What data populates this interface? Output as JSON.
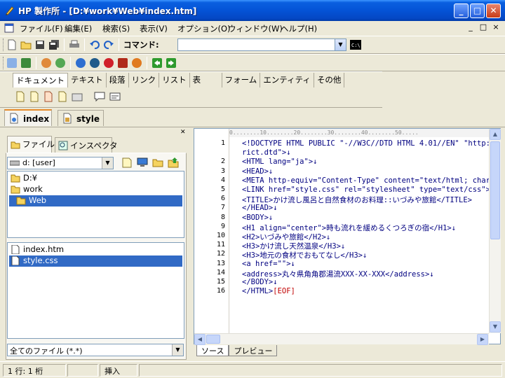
{
  "window": {
    "title": "HP 製作所 - [D:¥work¥Web¥index.htm]",
    "min_glyph": "_",
    "max_glyph": "□",
    "close_glyph": "✕"
  },
  "menu": [
    "ファイル(F)",
    "編集(E)",
    "検索(S)",
    "表示(V)",
    "オプション(O)",
    "ウィンドウ(W)",
    "ヘルプ(H)"
  ],
  "mdi_buttons": [
    "_",
    "□",
    "×"
  ],
  "command": {
    "label": "コマンド:",
    "value": ""
  },
  "tag_tabs": [
    "ドキュメント",
    "テキスト",
    "段落",
    "リンク",
    "リスト",
    "表",
    "フォーム",
    "エンティティ",
    "その他"
  ],
  "doc_tabs": [
    "index",
    "style"
  ],
  "left_panel": {
    "tabs": [
      "ファイル",
      "インスペクタ"
    ],
    "drive": "d: [user]",
    "folders": [
      "D:¥",
      "work",
      "Web"
    ],
    "files": [
      "index.htm",
      "style.css"
    ],
    "filter": "全てのファイル (*.*)"
  },
  "editor": {
    "ruler": "0........10........20........30........40........50.....",
    "line_numbers": [
      "1",
      "",
      "2",
      "3",
      "4",
      "5",
      "6",
      "7",
      "8",
      "9",
      "10",
      "11",
      "12",
      "13",
      "14",
      "15",
      "16"
    ],
    "lines": [
      "<!DOCTYPE HTML PUBLIC \"-//W3C//DTD HTML 4.01//EN\" \"http://w",
      "rict.dtd\">↓",
      "<HTML lang=\"ja\">↓",
      "<HEAD>↓",
      "<META http-equiv=\"Content-Type\" content=\"text/html; charset",
      "<LINK href=\"style.css\" rel=\"stylesheet\" type=\"text/css\">↓",
      "<TITLE>かけ流し風呂と自然食材のお料理::いづみや旅館</TITLE>",
      "</HEAD>↓",
      "<BODY>↓",
      "<H1 align=\"center\">時も流れを緩めるくつろぎの宿</H1>↓",
      "<H2>いづみや旅館</H2>↓",
      "<H3>かけ流し天然温泉</H3>↓",
      "<H3>地元の食材でおもてなし</H3>↓",
      "<a href=\"\">↓",
      "<address>丸々県角角郡湯流XXX-XX-XXX</address>↓",
      "</BODY>↓",
      "</HTML>[EOF]"
    ],
    "tabs": [
      "ソース",
      "プレビュー"
    ]
  },
  "status": {
    "position": "1 行:  1 桁",
    "mode": "挿入"
  },
  "colors": {
    "title_blue": "#0453d6",
    "selection": "#316ac5",
    "code_tag": "#000080",
    "eof": "#c00000"
  }
}
